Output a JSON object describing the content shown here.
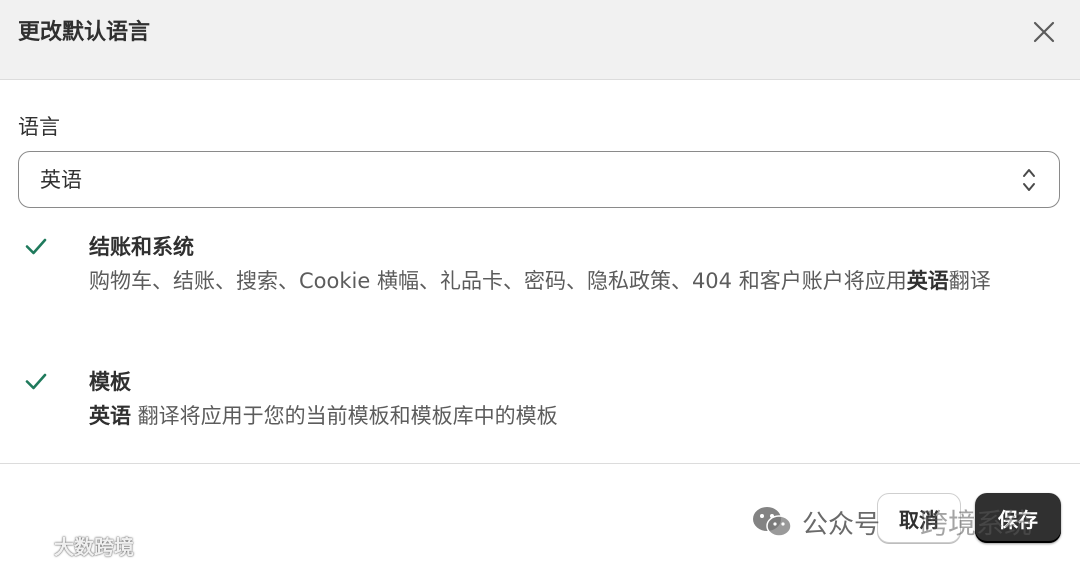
{
  "dialog": {
    "title": "更改默认语言"
  },
  "language_field": {
    "label": "语言",
    "selected": "英语"
  },
  "items": [
    {
      "title": "结账和系统",
      "desc_prefix": "购物车、结账、搜索、Cookie 横幅、礼品卡、密码、隐私政策、404 和客户账户将应用",
      "desc_lang": "英语",
      "desc_suffix": "翻译"
    },
    {
      "title": "模板",
      "desc_lang": "英语",
      "desc_suffix": " 翻译将应用于您的当前模板和模板库中的模板"
    }
  ],
  "footer": {
    "cancel_label": "取消",
    "save_label": "保存"
  },
  "watermarks": {
    "gzh_prefix": "公众号",
    "gzh_name": "跨境系统",
    "bottom_left": "大数跨境"
  },
  "icons": {
    "close": "close-icon",
    "select": "chevron-up-down-icon",
    "check": "checkmark-icon"
  },
  "colors": {
    "check": "#1f7a5c",
    "primary_button": "#303030",
    "header_bg": "#f1f1f1"
  }
}
